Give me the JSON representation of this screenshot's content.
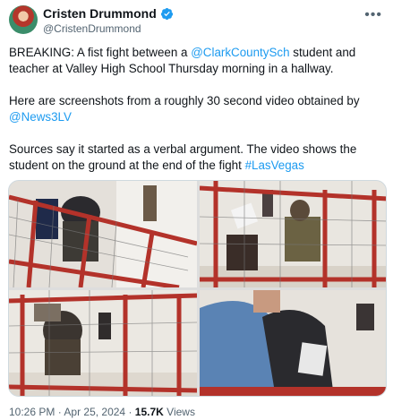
{
  "author": {
    "name": "Cristen Drummond",
    "handle": "@CristenDrummond",
    "verified_icon": "verified-badge-icon",
    "more_icon": "more-options-icon"
  },
  "tweet": {
    "p1_a": "BREAKING: A fist fight between a ",
    "p1_link": "@ClarkCountySch",
    "p1_b": " student and teacher at Valley High School Thursday morning in a hallway.",
    "p2_a": "Here are screenshots from a roughly 30 second video obtained by ",
    "p2_link": "@News3LV",
    "p3_a": "Sources say it started as a verbal argument. The video shows the student on the ground at the end of the fight ",
    "p3_link": "#LasVegas"
  },
  "media": {
    "images": [
      "video-screenshot-1",
      "video-screenshot-2",
      "video-screenshot-3",
      "video-screenshot-4"
    ]
  },
  "meta": {
    "time": "10:26 PM",
    "sep": "·",
    "date": "Apr 25, 2024",
    "views_count": "15.7K",
    "views_label": "Views"
  },
  "colors": {
    "link": "#1d9bf0",
    "secondary_text": "#536471",
    "railing": "#b3322a"
  }
}
